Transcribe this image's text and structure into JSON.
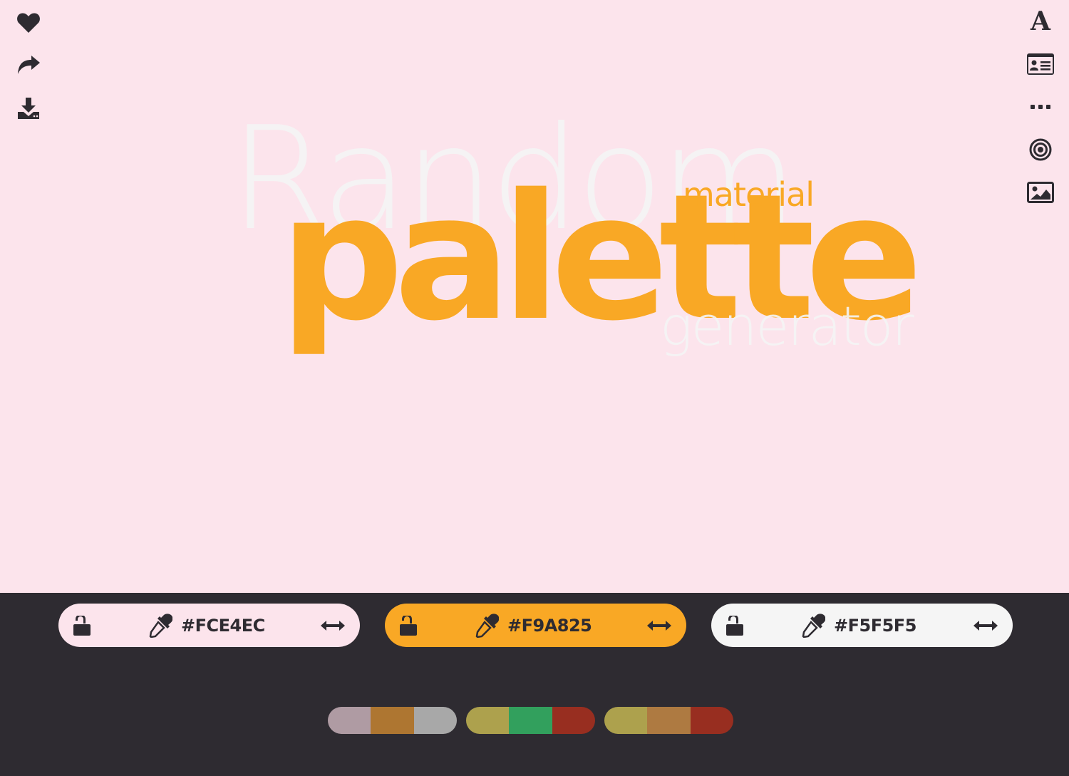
{
  "colors": {
    "canvas_bg": "#FCE4EC",
    "panel_bg": "#2E2B31",
    "icon": "#2E2B31",
    "primary": "#F9A825",
    "light": "#F5F5F5"
  },
  "toolbar_left": [
    {
      "name": "favorite",
      "icon": "heart-icon"
    },
    {
      "name": "share",
      "icon": "share-arrow-icon"
    },
    {
      "name": "download",
      "icon": "download-icon"
    }
  ],
  "toolbar_right": [
    {
      "name": "font",
      "icon": "font-icon",
      "label": "A"
    },
    {
      "name": "card",
      "icon": "id-card-icon"
    },
    {
      "name": "more",
      "icon": "ellipsis-icon"
    },
    {
      "name": "target",
      "icon": "target-icon"
    },
    {
      "name": "image",
      "icon": "image-icon"
    }
  ],
  "hero": {
    "word1": "Random",
    "word2": "material",
    "word3": "palette",
    "word4": "generator"
  },
  "swatches": [
    {
      "hex": "#FCE4EC",
      "color": "#FCE4EC",
      "locked": false
    },
    {
      "hex": "#F9A825",
      "color": "#F9A825",
      "locked": false
    },
    {
      "hex": "#F5F5F5",
      "color": "#F5F5F5",
      "locked": false
    }
  ],
  "suggestions": [
    {
      "colors": [
        "#AF9BA3",
        "#AE7631",
        "#A8A8A8"
      ]
    },
    {
      "colors": [
        "#ADA14D",
        "#32A05D",
        "#982E20"
      ]
    },
    {
      "colors": [
        "#ADA14D",
        "#AE7A41",
        "#982E20"
      ]
    }
  ]
}
